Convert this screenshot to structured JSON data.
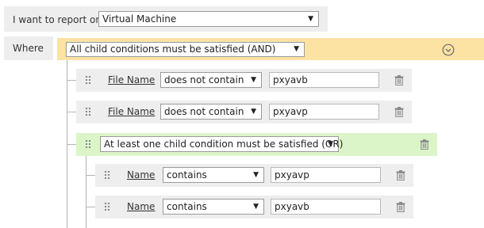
{
  "report": {
    "label": "I want to report on",
    "value": "Virtual Machine"
  },
  "where_label": "Where",
  "root": {
    "operator": "All child conditions must be satisfied (AND)",
    "color": "#fce3a4"
  },
  "conditions": [
    {
      "field": "File Name",
      "op": "does not contain",
      "value": "pxyavb"
    },
    {
      "field": "File Name",
      "op": "does not contain",
      "value": "pxyavp"
    }
  ],
  "group": {
    "operator": "At least one child condition must be satisfied (OR)",
    "color": "#dbf5c8"
  },
  "group_conditions": [
    {
      "field": "Name",
      "op": "contains",
      "value": "pxyavp"
    },
    {
      "field": "Name",
      "op": "contains",
      "value": "pxyavb"
    }
  ],
  "icons": {
    "caret": "▼",
    "collapse": "chevron-down-circle-icon",
    "delete": "trash-icon",
    "drag": "drag-handle-icon"
  }
}
